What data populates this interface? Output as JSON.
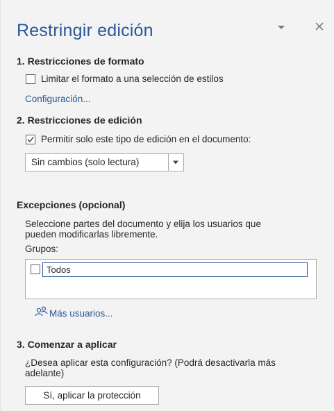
{
  "pane": {
    "title": "Restringir edición"
  },
  "format": {
    "heading": "1. Restricciones de formato",
    "limit_label": "Limitar el formato a una selección de estilos",
    "limit_checked": false,
    "settings_link": "Configuración..."
  },
  "editing": {
    "heading": "2. Restricciones de edición",
    "allow_label": "Permitir solo este tipo de edición en el documento:",
    "allow_checked": true,
    "select_value": "Sin cambios (solo lectura)"
  },
  "exceptions": {
    "heading": "Excepciones (opcional)",
    "description_line1": "Seleccione partes del documento y elija los usuarios que",
    "description_line2": "pueden modificarlas libremente.",
    "groups_label": "Grupos:",
    "groups": [
      {
        "name": "Todos",
        "checked": false
      }
    ],
    "more_users_link": "Más usuarios..."
  },
  "apply": {
    "heading": "3. Comenzar a aplicar",
    "question_line1": "¿Desea aplicar esta configuración? (Podrá desactivarla más",
    "question_line2": "adelante)",
    "button_label": "Sí, aplicar la protección"
  },
  "colors": {
    "accent": "#2b579a",
    "pane_bg": "#f3f3f3"
  }
}
